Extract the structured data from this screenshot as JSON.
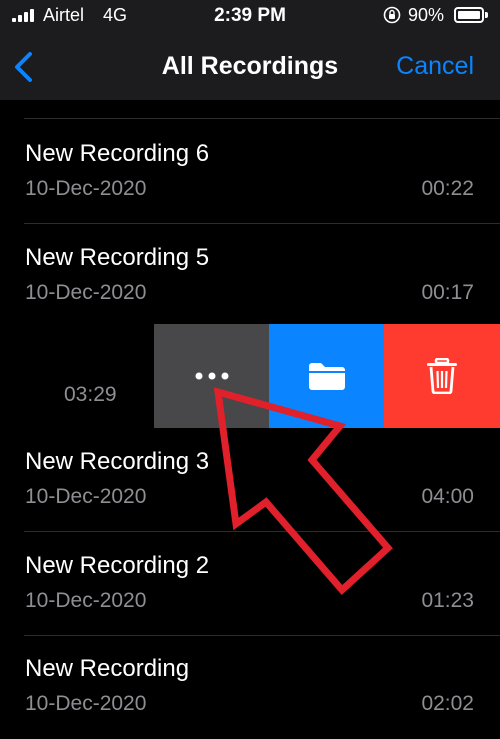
{
  "status_bar": {
    "carrier": "Airtel",
    "network": "4G",
    "time": "2:39 PM",
    "battery_percent": "90%",
    "icons": [
      "signal-icon",
      "orientation-lock-icon",
      "battery-icon"
    ]
  },
  "nav": {
    "back_icon": "chevron-left-icon",
    "title": "All Recordings",
    "cancel_label": "Cancel"
  },
  "recordings": [
    {
      "title": "New Recording 6",
      "date": "10-Dec-2020",
      "duration": "00:22"
    },
    {
      "title": "New Recording 5",
      "date": "10-Dec-2020",
      "duration": "00:17"
    },
    {
      "title": "New Recording 3",
      "date": "10-Dec-2020",
      "duration": "04:00"
    },
    {
      "title": "New Recording 2",
      "date": "10-Dec-2020",
      "duration": "01:23"
    },
    {
      "title": "New Recording",
      "date": "10-Dec-2020",
      "duration": "02:02"
    }
  ],
  "swiped_row": {
    "duration": "03:29",
    "actions": [
      "more-icon",
      "folder-icon",
      "trash-icon"
    ]
  },
  "colors": {
    "background": "#000000",
    "bar_background": "#1c1c1e",
    "accent_blue": "#0a84ff",
    "delete_red": "#ff3b30",
    "more_gray": "#48484a",
    "secondary_text": "#8e8e93",
    "annotation_arrow": "#e0202a"
  }
}
